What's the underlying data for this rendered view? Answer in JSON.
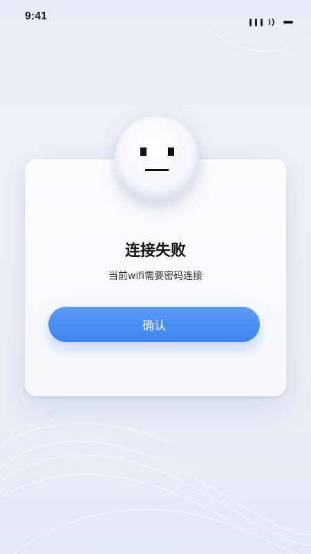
{
  "status_bar": {
    "time": "9:41",
    "signal_icon": "signal-bars-icon",
    "wifi_icon": "wifi-icon",
    "battery_icon": "battery-icon"
  },
  "dialog": {
    "icon": "neutral-face-icon",
    "title": "连接失败",
    "message": "当前wifi需要密码连接",
    "confirm_label": "确认"
  },
  "colors": {
    "accent": "#4a8ef3",
    "background": "#eceff7",
    "card": "#f9fafd"
  }
}
